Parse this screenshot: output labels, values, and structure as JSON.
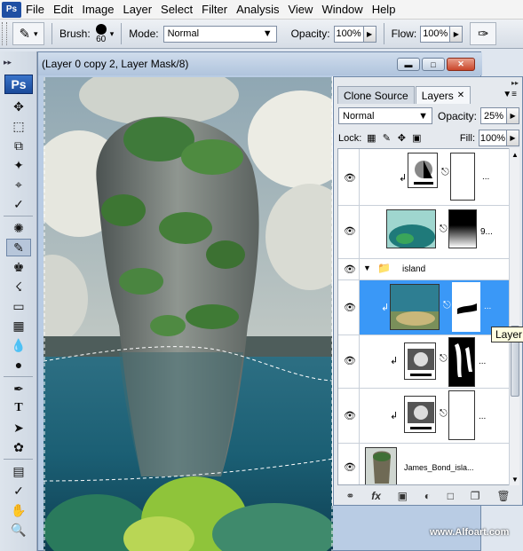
{
  "menubar": {
    "logo": "Ps",
    "items": [
      "File",
      "Edit",
      "Image",
      "Layer",
      "Select",
      "Filter",
      "Analysis",
      "View",
      "Window",
      "Help"
    ]
  },
  "options": {
    "brush_label": "Brush:",
    "brush_size": "60",
    "mode_label": "Mode:",
    "mode_value": "Normal",
    "opacity_label": "Opacity:",
    "opacity_value": "100%",
    "flow_label": "Flow:",
    "flow_value": "100%"
  },
  "document": {
    "title": "(Layer 0 copy 2, Layer Mask/8)"
  },
  "toolbox": {
    "logo": "Ps"
  },
  "panel": {
    "tabs": [
      "Clone Source",
      "Layers"
    ],
    "blend_mode": "Normal",
    "opacity_label": "Opacity:",
    "opacity_value": "25%",
    "lock_label": "Lock:",
    "fill_label": "Fill:",
    "fill_value": "100%",
    "layers": [
      {
        "name": "...",
        "kind": "adjustment"
      },
      {
        "name": "9...",
        "kind": "image-with-gradient-mask"
      },
      {
        "name": "island",
        "kind": "group"
      },
      {
        "name": "...",
        "kind": "image-with-mask",
        "selected": true
      },
      {
        "name": "...",
        "kind": "adjustment-with-mask"
      },
      {
        "name": "...",
        "kind": "adjustment"
      },
      {
        "name": "James_Bond_isla...",
        "kind": "image"
      }
    ]
  },
  "tooltip": "Layer",
  "watermark": "www.Alfoart.com",
  "colors": {
    "selection_blue": "#3a98f7",
    "ps_blue": "#1f4fa3"
  }
}
